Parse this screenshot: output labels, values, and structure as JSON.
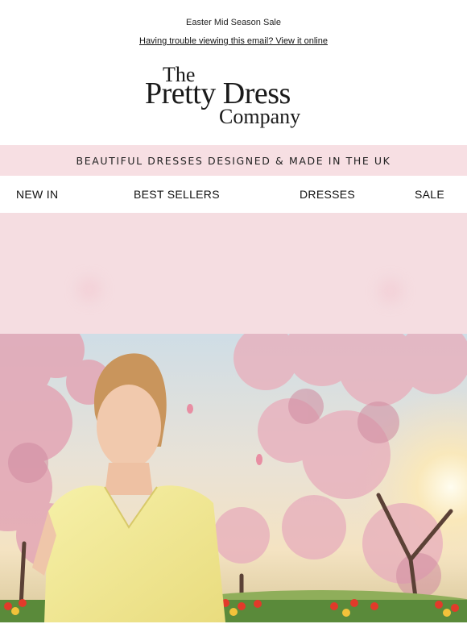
{
  "preheader": {
    "text": "Easter Mid Season Sale"
  },
  "view_online": {
    "text": "Having trouble viewing this email? View it online"
  },
  "logo": {
    "line1": "The",
    "line2": "Pretty Dress",
    "line3": "Company"
  },
  "tagline": {
    "text": "BEAUTIFUL DRESSES DESIGNED & MADE IN THE UK"
  },
  "nav": {
    "items": [
      "NEW IN",
      "BEST SELLERS",
      "DRESSES",
      "SALE"
    ]
  },
  "colors": {
    "tagline_bg": "#f7dfe3",
    "band_bg": "#f5dde1",
    "dress": "#f3ec9a"
  },
  "hero": {
    "description_icon": "hero-photo"
  }
}
